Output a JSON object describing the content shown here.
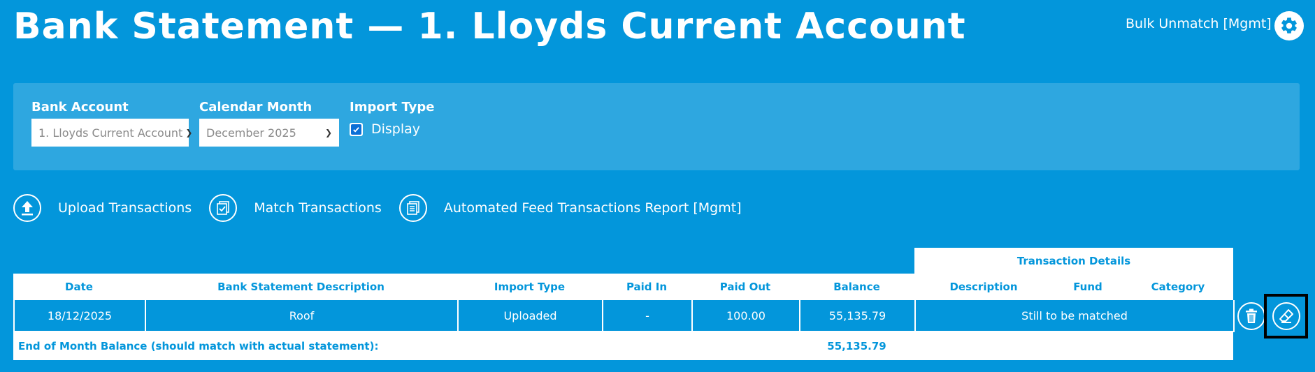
{
  "page": {
    "title": "Bank Statement — 1. Lloyds Current Account",
    "bulk_unmatch_label": "Bulk Unmatch [Mgmt]"
  },
  "filters": {
    "bank_account": {
      "label": "Bank Account",
      "value": "1. Lloyds Current Account"
    },
    "calendar_month": {
      "label": "Calendar Month",
      "value": "December 2025"
    },
    "import_type": {
      "label": "Import Type",
      "option_label": "Display",
      "checked": true
    }
  },
  "actions": [
    {
      "label": "Upload Transactions",
      "icon": "upload-icon"
    },
    {
      "label": "Match Transactions",
      "icon": "match-icon"
    },
    {
      "label": "Automated Feed Transactions Report [Mgmt]",
      "icon": "report-icon"
    }
  ],
  "table": {
    "group_header": "Transaction Details",
    "columns": [
      "Date",
      "Bank Statement Description",
      "Import Type",
      "Paid In",
      "Paid Out",
      "Balance",
      "Description",
      "Fund",
      "Category"
    ],
    "rows": [
      {
        "date": "18/12/2025",
        "description": "Roof",
        "import_type": "Uploaded",
        "paid_in": "-",
        "paid_out": "100.00",
        "balance": "55,135.79",
        "details": "Still to be matched"
      }
    ],
    "footer_label": "End of Month Balance (should match with actual statement):",
    "footer_balance": "55,135.79"
  },
  "colors": {
    "background": "#0396db",
    "panel": "#2ea7e0",
    "text": "#ffffff"
  }
}
